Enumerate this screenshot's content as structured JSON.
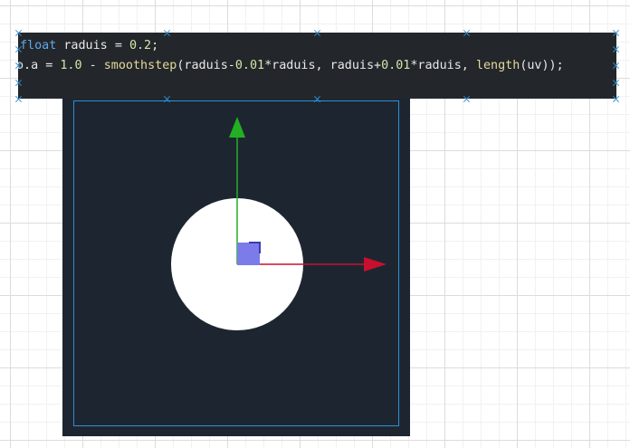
{
  "code": {
    "lines": [
      [
        {
          "cls": "kw",
          "text": "float"
        },
        {
          "cls": "id",
          "text": " raduis "
        },
        {
          "cls": "op",
          "text": "= "
        },
        {
          "cls": "num",
          "text": "0.2"
        },
        {
          "cls": "op",
          "text": ";"
        }
      ],
      [
        {
          "cls": "id",
          "text": "o.a "
        },
        {
          "cls": "op",
          "text": "= "
        },
        {
          "cls": "num",
          "text": "1.0"
        },
        {
          "cls": "op",
          "text": " - "
        },
        {
          "cls": "fn",
          "text": "smoothstep"
        },
        {
          "cls": "op",
          "text": "(raduis-"
        },
        {
          "cls": "num",
          "text": "0.01"
        },
        {
          "cls": "op",
          "text": "*raduis, raduis+"
        },
        {
          "cls": "num",
          "text": "0.01"
        },
        {
          "cls": "op",
          "text": "*raduis, "
        },
        {
          "cls": "fn",
          "text": "length"
        },
        {
          "cls": "op",
          "text": "(uv));"
        }
      ]
    ]
  },
  "scene": {
    "background": "#1d2630",
    "circle_color": "#ffffff",
    "x_axis_color": "#c8102e",
    "y_axis_color": "#22b022",
    "center_marker_color": "#7b7bea",
    "frame_color": "#2f8fd6",
    "icons": {
      "x_arrow": "red-arrow-right",
      "y_arrow": "green-arrow-up",
      "center": "blue-square-handle"
    }
  },
  "selection": {
    "handle_icon": "x-mark",
    "handle_color": "#2f8fd6"
  }
}
